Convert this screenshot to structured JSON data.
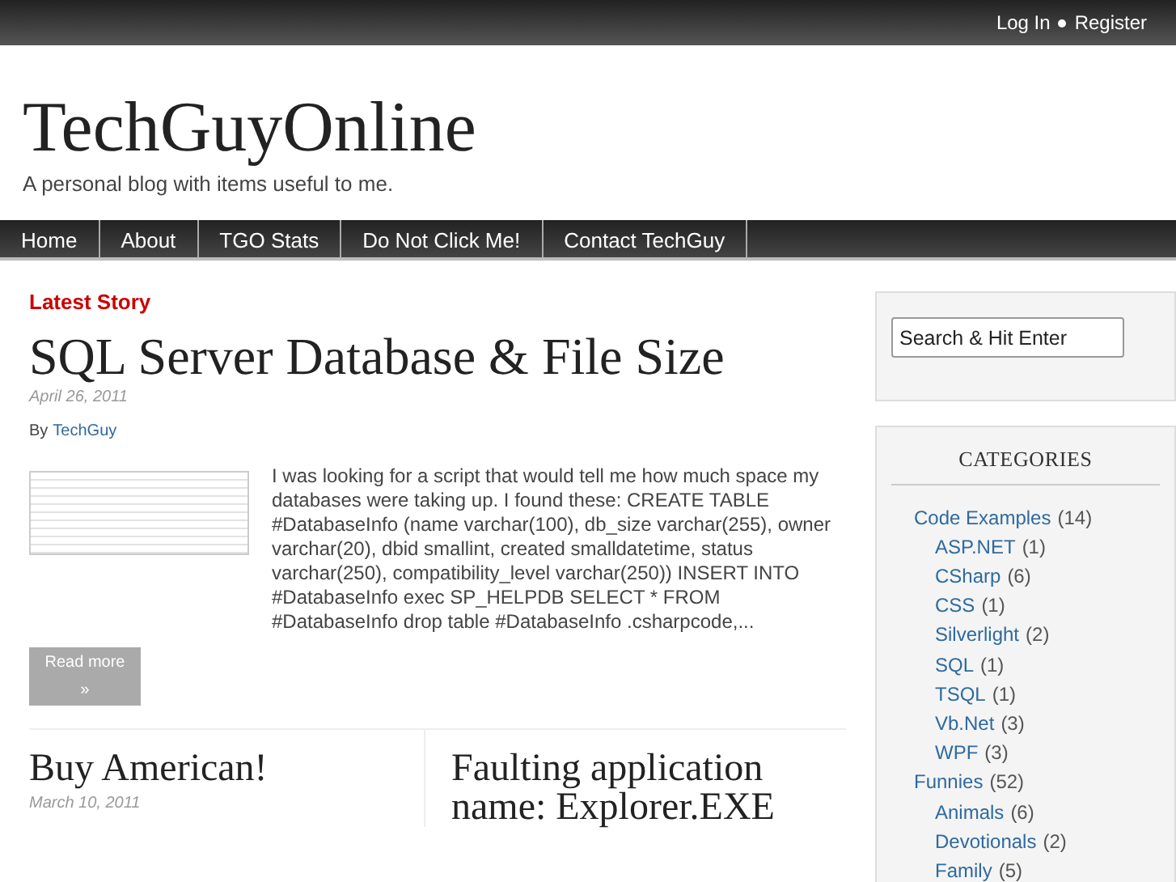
{
  "top_links": [
    "Log In",
    "Register"
  ],
  "site": {
    "title": "TechGuyOnline",
    "tagline": "A personal blog with items useful to me."
  },
  "nav": [
    {
      "label": "Home"
    },
    {
      "label": "About"
    },
    {
      "label": "TGO Stats"
    },
    {
      "label": "Do Not Click Me!"
    },
    {
      "label": "Contact TechGuy"
    }
  ],
  "latest": {
    "heading": "Latest Story",
    "title": "SQL Server Database & File Size",
    "date": "April 26, 2011",
    "by": "By",
    "author": "TechGuy",
    "excerpt": "I was looking for a script that would tell me how much space my databases were taking up. I found these: CREATE TABLE #DatabaseInfo (name varchar(100), db_size varchar(255), owner varchar(20), dbid smallint, created smalldatetime, status varchar(250), compatibility_level varchar(250))   INSERT INTO #DatabaseInfo exec SP_HELPDB   SELECT * FROM #DatabaseInfo   drop table #DatabaseInfo .csharpcode,...",
    "read_more": "Read more",
    "read_more_arrow": "»"
  },
  "posts": [
    {
      "title": "Buy American!",
      "date": "March 10, 2011"
    },
    {
      "title": "Faulting application name: Explorer.EXE"
    }
  ],
  "search": {
    "value": "Search & Hit Enter"
  },
  "categories": {
    "heading": "CATEGORIES",
    "items": [
      {
        "name": "Code Examples",
        "count": "(14)",
        "children": [
          {
            "name": "ASP.NET",
            "count": "(1)"
          },
          {
            "name": "CSharp",
            "count": "(6)"
          },
          {
            "name": "CSS",
            "count": "(1)"
          },
          {
            "name": "Silverlight",
            "count": "(2)"
          },
          {
            "name": "SQL",
            "count": "(1)"
          },
          {
            "name": "TSQL",
            "count": "(1)"
          },
          {
            "name": "Vb.Net",
            "count": "(3)"
          },
          {
            "name": "WPF",
            "count": "(3)"
          }
        ]
      },
      {
        "name": "Funnies",
        "count": "(52)",
        "children": [
          {
            "name": "Animals",
            "count": "(6)"
          },
          {
            "name": "Devotionals",
            "count": "(2)"
          },
          {
            "name": "Family",
            "count": "(5)"
          }
        ]
      }
    ]
  }
}
